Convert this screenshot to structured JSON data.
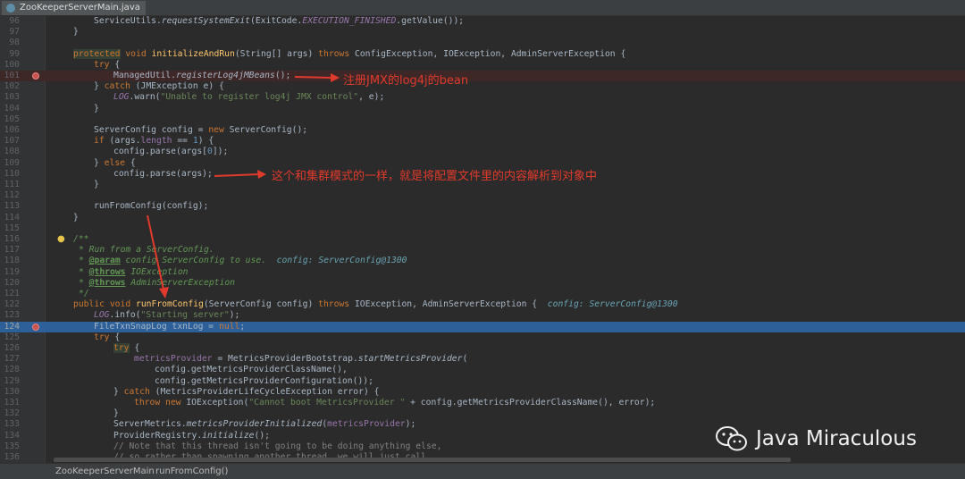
{
  "tab": {
    "label": "ZooKeeperServerMain.java"
  },
  "code": {
    "l96": {
      "num": "96",
      "a": "ServiceUtils.",
      "b": "requestSystemExit",
      "c": "(ExitCode.",
      "d": "EXECUTION_FINISHED",
      "e": ".getValue());"
    },
    "l97": {
      "num": "97",
      "a": "}"
    },
    "l98": {
      "num": "98"
    },
    "l99": {
      "num": "99",
      "a": "protected",
      "b": " void ",
      "c": "initializeAndRun",
      "d": "(String[] args) ",
      "e": "throws",
      "f": " ConfigException, IOException, AdminServerException {"
    },
    "l100": {
      "num": "100",
      "a": "try",
      "b": " {"
    },
    "l101": {
      "num": "101",
      "a": "ManagedUtil.",
      "b": "registerLog4jMBeans",
      "c": "();"
    },
    "l102": {
      "num": "102",
      "a": "} ",
      "b": "catch",
      "c": " (JMException e) {"
    },
    "l103": {
      "num": "103",
      "a": "LOG",
      "b": ".warn(",
      "c": "\"Unable to register log4j JMX control\"",
      "d": ", e);"
    },
    "l104": {
      "num": "104",
      "a": "}"
    },
    "l105": {
      "num": "105"
    },
    "l106": {
      "num": "106",
      "a": "ServerConfig config = ",
      "b": "new",
      "c": " ServerConfig();"
    },
    "l107": {
      "num": "107",
      "a": "if",
      "b": " (args.",
      "c": "length",
      "d": " == ",
      "e": "1",
      "f": ") {"
    },
    "l108": {
      "num": "108",
      "a": "config.parse(args[",
      "b": "0",
      "c": "]);"
    },
    "l109": {
      "num": "109",
      "a": "} ",
      "b": "else",
      "c": " {"
    },
    "l110": {
      "num": "110",
      "a": "config.parse(args);"
    },
    "l111": {
      "num": "111",
      "a": "}"
    },
    "l112": {
      "num": "112"
    },
    "l113": {
      "num": "113",
      "a": "runFromConfig(config);"
    },
    "l114": {
      "num": "114",
      "a": "}"
    },
    "l115": {
      "num": "115"
    },
    "l116": {
      "num": "116",
      "a": "/**"
    },
    "l117": {
      "num": "117",
      "a": "* Run from a ServerConfig."
    },
    "l118": {
      "num": "118",
      "a": "* ",
      "b": "@param",
      "c": " config ServerConfig to use.",
      "d": "config: ServerConfig@1300"
    },
    "l119": {
      "num": "119",
      "a": "* ",
      "b": "@throws",
      "c": " IOException"
    },
    "l120": {
      "num": "120",
      "a": "* ",
      "b": "@throws",
      "c": " AdminServerException"
    },
    "l121": {
      "num": "121",
      "a": "*/"
    },
    "l122": {
      "num": "122",
      "a": "public",
      "b": " void ",
      "c": "runFromConfig",
      "d": "(ServerConfig config) ",
      "e": "throws",
      "f": " IOException, AdminServerException {",
      "g": "config: ServerConfig@1300"
    },
    "l123": {
      "num": "123",
      "a": "LOG",
      "b": ".info(",
      "c": "\"Starting server\"",
      "d": ");"
    },
    "l124": {
      "num": "124",
      "a": "FileTxnSnapLog txnLog = ",
      "b": "null",
      "c": ";"
    },
    "l125": {
      "num": "125",
      "a": "try",
      "b": " {"
    },
    "l126": {
      "num": "126",
      "a": "try",
      "b": " {"
    },
    "l127": {
      "num": "127",
      "a": "metricsProvider",
      "b": " = MetricsProviderBootstrap.",
      "c": "startMetricsProvider",
      "d": "("
    },
    "l128": {
      "num": "128",
      "a": "config.getMetricsProviderClassName(),"
    },
    "l129": {
      "num": "129",
      "a": "config.getMetricsProviderConfiguration());"
    },
    "l130": {
      "num": "130",
      "a": "} ",
      "b": "catch",
      "c": " (MetricsProviderLifeCycleException error) {"
    },
    "l131": {
      "num": "131",
      "a": "throw new",
      "b": " IOException(",
      "c": "\"Cannot boot MetricsProvider \"",
      "d": " + config.getMetricsProviderClassName(), error);"
    },
    "l132": {
      "num": "132",
      "a": "}"
    },
    "l133": {
      "num": "133",
      "a": "ServerMetrics.",
      "b": "metricsProviderInitialized",
      "c": "(",
      "d": "metricsProvider",
      "e": ");"
    },
    "l134": {
      "num": "134",
      "a": "ProviderRegistry.",
      "b": "initialize",
      "c": "();"
    },
    "l135": {
      "num": "135",
      "a": "// Note that this thread isn't going to be doing anything else,"
    },
    "l136": {
      "num": "136",
      "a": "// so rather than spawning another thread, we will just call"
    }
  },
  "annotations": {
    "a1": "注册JMX的log4j的bean",
    "a2": "这个和集群模式的一样，就是将配置文件里的内容解析到对象中"
  },
  "breadcrumb": {
    "file": "ZooKeeperServerMain",
    "method": "runFromConfig()"
  },
  "watermark": {
    "text": "Java Miraculous",
    "icon": "wechat-icon"
  },
  "colors": {
    "annotation": "#e03a2c",
    "selection": "#2d6099",
    "error_line": "#3e2727",
    "breakpoint": "#c75450"
  }
}
